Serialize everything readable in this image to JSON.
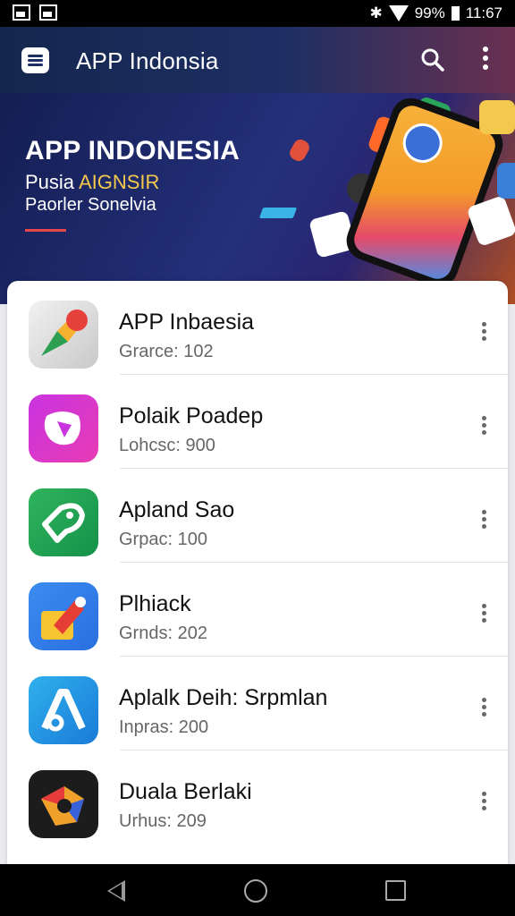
{
  "status": {
    "battery": "99%",
    "time": "11:67"
  },
  "appbar": {
    "title": "APP Indonsia"
  },
  "hero": {
    "title": "APP INDONESIA",
    "sub1_a": "Pusia ",
    "sub1_b": "AIGNSIR",
    "sub2": "Paorler Sonelvia"
  },
  "apps": [
    {
      "name": "APP Inbaesia",
      "meta": "Grarce: 102",
      "icon": "maps-icon"
    },
    {
      "name": "Polaik Poadep",
      "meta": "Lohcsc: 900",
      "icon": "purple-app-icon"
    },
    {
      "name": "Apland Sao",
      "meta": "Grpac: 100",
      "icon": "green-app-icon"
    },
    {
      "name": "Plhiack",
      "meta": "Grnds: 202",
      "icon": "edit-app-icon"
    },
    {
      "name": "Aplalk Deih: Srpmlan",
      "meta": "Inpras: 200",
      "icon": "blue-a-app-icon"
    },
    {
      "name": "Duala Berlaki",
      "meta": "Urhus: 209",
      "icon": "dark-app-icon"
    }
  ]
}
